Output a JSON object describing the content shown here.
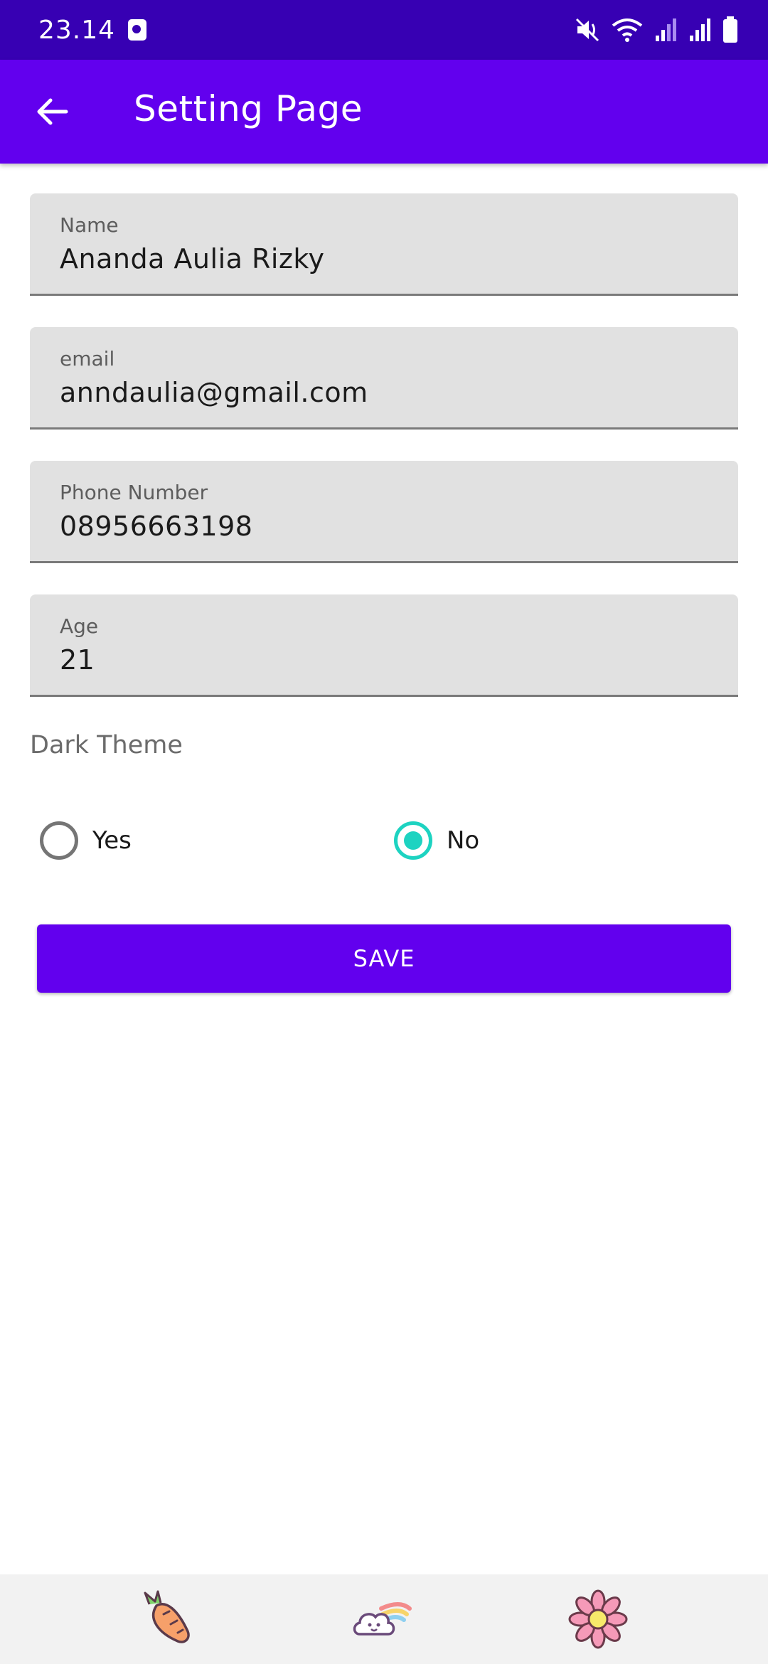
{
  "status_bar": {
    "time": "23.14"
  },
  "app_bar": {
    "title": "Setting Page"
  },
  "fields": {
    "name": {
      "label": "Name",
      "value": "Ananda Aulia Rizky"
    },
    "email": {
      "label": "email",
      "value": "anndaulia@gmail.com"
    },
    "phone": {
      "label": "Phone Number",
      "value": "08956663198"
    },
    "age": {
      "label": "Age",
      "value": "21"
    }
  },
  "dark_theme": {
    "label": "Dark Theme",
    "options": [
      {
        "label": "Yes",
        "checked": false
      },
      {
        "label": "No",
        "checked": true
      }
    ]
  },
  "save_button": {
    "label": "SAVE"
  },
  "bottom_nav": {
    "icons": [
      "carrot-icon",
      "cloud-rainbow-icon",
      "flower-icon"
    ]
  },
  "colors": {
    "primary": "#6200EE",
    "primary_dark": "#3700B3",
    "accent": "#1DD3C1",
    "field_bg": "#E1E1E1"
  }
}
